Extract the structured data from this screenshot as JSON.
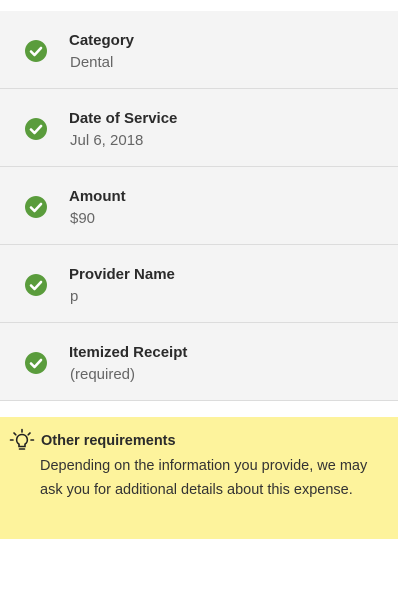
{
  "colors": {
    "check": "#5a9c3c",
    "list_bg": "#f4f4f4",
    "notice_bg": "#fdf39c"
  },
  "fields": [
    {
      "label": "Category",
      "value": "Dental",
      "icon": "check-circle-icon"
    },
    {
      "label": "Date of Service",
      "value": "Jul 6, 2018",
      "icon": "check-circle-icon"
    },
    {
      "label": "Amount",
      "value": "$90",
      "icon": "check-circle-icon"
    },
    {
      "label": "Provider Name",
      "value": "p",
      "icon": "check-circle-icon"
    },
    {
      "label": "Itemized Receipt",
      "value": "(required)",
      "icon": "check-circle-icon"
    }
  ],
  "notice": {
    "icon": "lightbulb-icon",
    "title": "Other requirements",
    "body": "Depending on the information you provide, we may ask you for additional details about this expense."
  }
}
